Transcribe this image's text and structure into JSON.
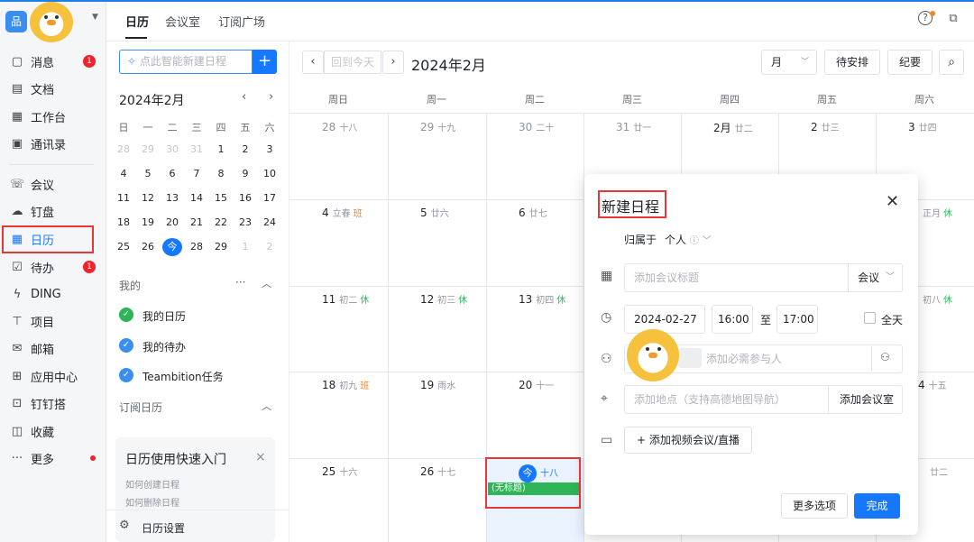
{
  "app": {
    "logo_glyph": "品"
  },
  "nav": {
    "items": [
      {
        "label": "消息",
        "icon": "message-icon",
        "badge": "1"
      },
      {
        "label": "文档",
        "icon": "document-icon"
      },
      {
        "label": "工作台",
        "icon": "workbench-icon"
      },
      {
        "label": "通讯录",
        "icon": "contacts-icon"
      },
      {
        "label": "会议",
        "icon": "meeting-icon"
      },
      {
        "label": "钉盘",
        "icon": "cloud-drive-icon"
      },
      {
        "label": "日历",
        "icon": "calendar-icon"
      },
      {
        "label": "待办",
        "icon": "todo-icon",
        "badge": "1"
      },
      {
        "label": "DING",
        "icon": "ding-icon"
      },
      {
        "label": "项目",
        "icon": "project-icon"
      },
      {
        "label": "邮箱",
        "icon": "mail-icon"
      },
      {
        "label": "应用中心",
        "icon": "apps-icon"
      },
      {
        "label": "钉钉搭",
        "icon": "builder-icon"
      },
      {
        "label": "收藏",
        "icon": "favorites-icon"
      },
      {
        "label": "更多",
        "icon": "more-icon"
      }
    ]
  },
  "header": {
    "tabs": [
      "日历",
      "会议室",
      "订阅广场"
    ]
  },
  "left": {
    "search_placeholder": "点此智能新建日程",
    "month_title": "2024年2月",
    "weekdays": [
      "日",
      "一",
      "二",
      "三",
      "四",
      "五",
      "六"
    ],
    "weeks": [
      [
        "28",
        "29",
        "30",
        "31",
        "1",
        "2",
        "3"
      ],
      [
        "4",
        "5",
        "6",
        "7",
        "8",
        "9",
        "10"
      ],
      [
        "11",
        "12",
        "13",
        "14",
        "15",
        "16",
        "17"
      ],
      [
        "18",
        "19",
        "20",
        "21",
        "22",
        "23",
        "24"
      ],
      [
        "25",
        "26",
        "今",
        "28",
        "29",
        "1",
        "2"
      ]
    ],
    "mine_label": "我的",
    "calendars": [
      "我的日历",
      "我的待办",
      "Teambition任务"
    ],
    "subscribed_label": "订阅日历",
    "quick": {
      "title": "日历使用快速入门",
      "links": [
        "如何创建日程",
        "如何删除日程"
      ]
    },
    "settings_label": "日历设置"
  },
  "calendar": {
    "today_btn": "回到今天",
    "month_title": "2024年2月",
    "view_select": "月",
    "pending_btn": "待安排",
    "summary_btn": "纪要",
    "weekday_headers": [
      "周日",
      "周一",
      "周二",
      "周三",
      "周四",
      "周五",
      "周六"
    ],
    "rows": [
      [
        [
          "28",
          "十八"
        ],
        [
          "29",
          "十九"
        ],
        [
          "30",
          "二十"
        ],
        [
          "31",
          "廿一"
        ],
        [
          "2月",
          "廿二"
        ],
        [
          "2",
          "廿三"
        ],
        [
          "3",
          "廿四"
        ]
      ],
      [
        [
          "4",
          "立春",
          "班"
        ],
        [
          "5",
          "廿六"
        ],
        [
          "6",
          "廿七"
        ],
        [
          "",
          "",
          ""
        ],
        [
          "",
          "",
          ""
        ],
        [
          "",
          "",
          ""
        ],
        [
          "",
          "正月",
          "休"
        ]
      ],
      [
        [
          "11",
          "初二",
          "休"
        ],
        [
          "12",
          "初三",
          "休"
        ],
        [
          "13",
          "初四",
          "休"
        ],
        [
          "",
          "",
          ""
        ],
        [
          "",
          "",
          ""
        ],
        [
          "",
          "",
          ""
        ],
        [
          "",
          "初八",
          "休"
        ]
      ],
      [
        [
          "18",
          "初九",
          "班"
        ],
        [
          "19",
          "雨水"
        ],
        [
          "20",
          "十一"
        ],
        [
          "",
          "",
          ""
        ],
        [
          "",
          "",
          ""
        ],
        [
          "",
          "",
          ""
        ],
        [
          "4",
          "十五"
        ]
      ],
      [
        [
          "25",
          "十六"
        ],
        [
          "26",
          "十七"
        ],
        [
          "今",
          "十八"
        ],
        [
          "",
          "",
          ""
        ],
        [
          "",
          "",
          ""
        ],
        [
          "",
          "",
          ""
        ],
        [
          "",
          "廿二"
        ]
      ]
    ],
    "event_title": "(无标题)"
  },
  "dialog": {
    "title": "新建日程",
    "owner_label": "归属于",
    "owner_value": "个人",
    "title_placeholder": "添加会议标题",
    "type_select": "会议",
    "date": "2024-02-27",
    "start_time": "16:00",
    "to_label": "至",
    "end_time": "17:00",
    "all_day": "全天",
    "attendee_placeholder": "添加必需参与人",
    "location_placeholder": "添加地点（支持高德地图导航）",
    "add_room": "添加会议室",
    "add_video": "添加视频会议/直播",
    "more_btn": "更多选项",
    "done_btn": "完成"
  },
  "colors": {
    "accent": "#1677ff",
    "highlight_box": "#e53935",
    "event_green": "#2db557"
  }
}
